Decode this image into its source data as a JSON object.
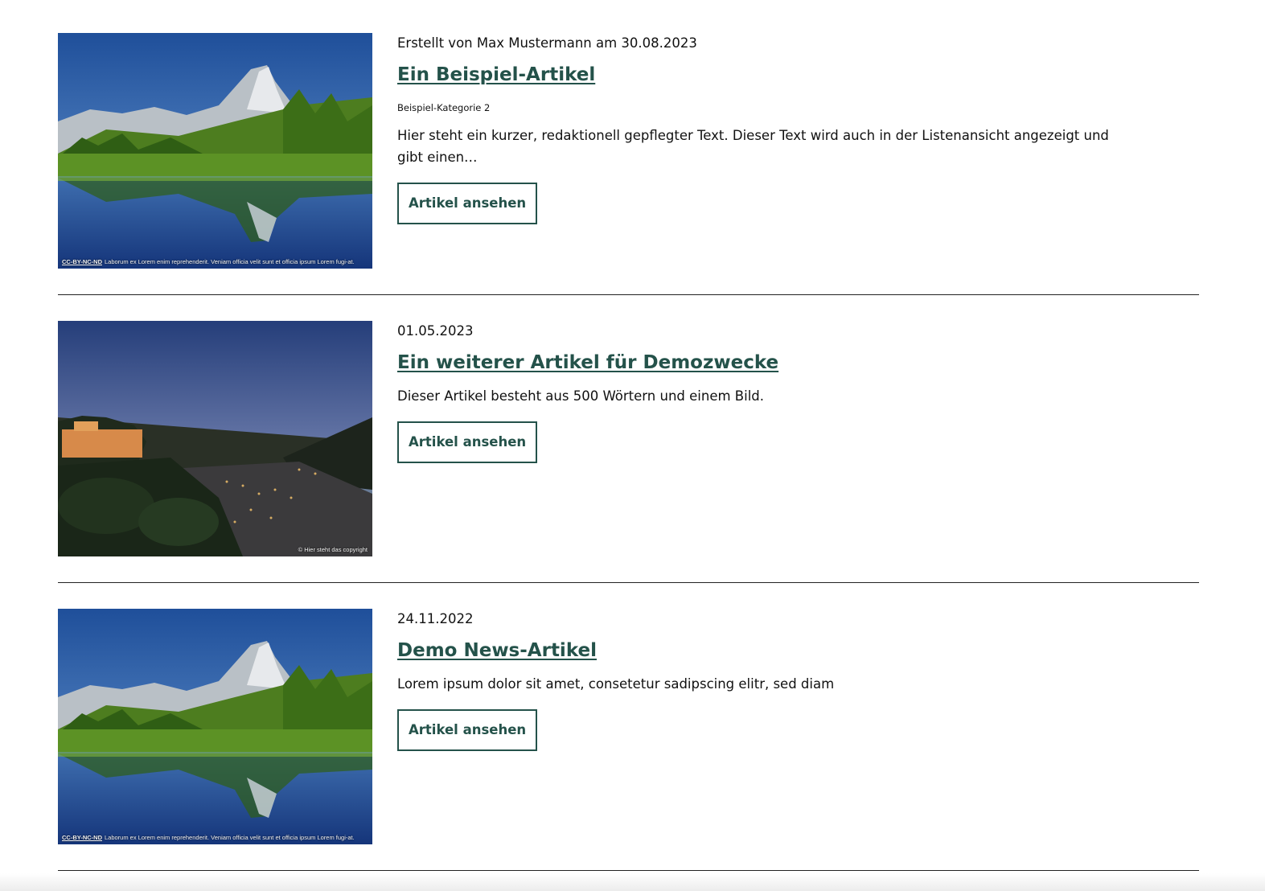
{
  "articles": [
    {
      "meta": "Erstellt von Max Mustermann am 30.08.2023",
      "title": "Ein Beispiel-Artikel",
      "category": "Beispiel-Kategorie 2",
      "teaser": "Hier steht ein kurzer, redaktionell gepflegter Text. Dieser Text wird auch in der Listenansicht angezeigt und gibt einen…",
      "button_label": "Artikel ansehen",
      "image": {
        "license": "CC-BY-NC-ND",
        "caption": "Laborum ex Lorem enim reprehenderit. Veniam officia velit sunt et officia ipsum Lorem fugi-at."
      }
    },
    {
      "meta": "01.05.2023",
      "title": "Ein weiterer Artikel für Demozwecke",
      "teaser": "Dieser Artikel besteht aus 500 Wörtern und einem Bild.",
      "button_label": "Artikel ansehen",
      "image": {
        "copyright": "© Hier steht das copyright"
      }
    },
    {
      "meta": "24.11.2022",
      "title": "Demo News-Artikel",
      "teaser": "Lorem ipsum dolor sit amet, consetetur sadipscing elitr, sed diam",
      "button_label": "Artikel ansehen",
      "image": {
        "license": "CC-BY-NC-ND",
        "caption": "Laborum ex Lorem enim reprehenderit. Veniam officia velit sunt et officia ipsum Lorem fugi-at."
      }
    }
  ],
  "colors": {
    "accent": "#24524a",
    "text": "#111111",
    "divider": "#222222"
  }
}
